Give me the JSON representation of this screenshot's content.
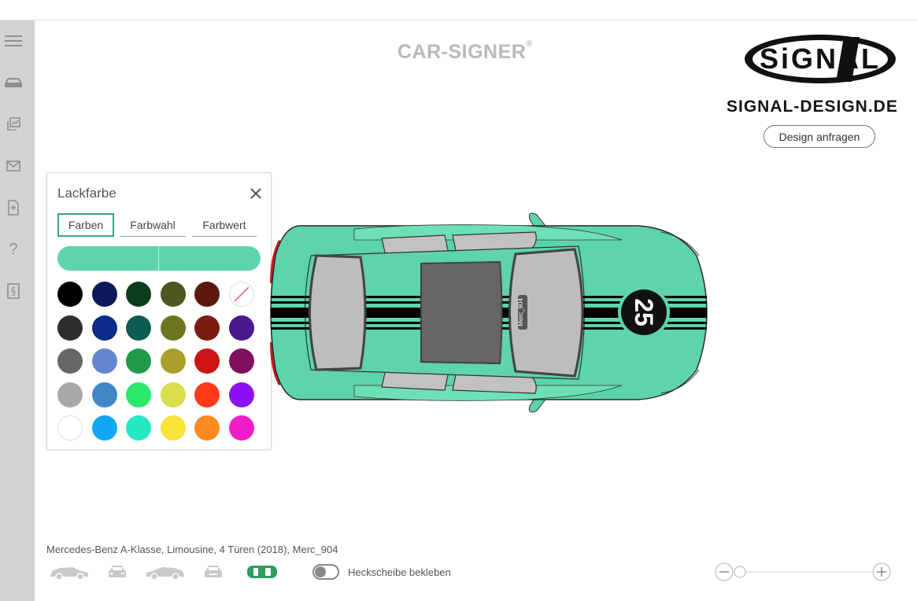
{
  "brand": {
    "name": "CAR-SIGNER",
    "registered": "®"
  },
  "logo": {
    "text": "SiGNAL"
  },
  "site": {
    "domain": "SIGNAL-DESIGN.DE"
  },
  "actions": {
    "request_design": "Design anfragen"
  },
  "sidebar": {
    "items": [
      {
        "icon": "menu-icon"
      },
      {
        "icon": "car-icon"
      },
      {
        "icon": "gallery-icon"
      },
      {
        "icon": "mail-icon"
      },
      {
        "icon": "document-icon"
      },
      {
        "icon": "help-icon",
        "glyph": "?"
      },
      {
        "icon": "legal-icon",
        "glyph": "§"
      }
    ]
  },
  "paint_panel": {
    "title": "Lackfarbe",
    "tabs": [
      {
        "label": "Farben",
        "active": true
      },
      {
        "label": "Farbwahl",
        "active": false
      },
      {
        "label": "Farbwert",
        "active": false
      }
    ],
    "current_color": "#5dd4a9",
    "swatches": [
      [
        "#000000",
        "#0d1a5a",
        "#0b3d1d",
        "#4f5520",
        "#5b180d",
        "none"
      ],
      [
        "#2e2e2e",
        "#0c2b8a",
        "#0d5c50",
        "#6b7520",
        "#7a1c10",
        "#4a1a8c"
      ],
      [
        "#666666",
        "#6485cf",
        "#1e9b4a",
        "#a8a02a",
        "#cc1414",
        "#7e0f5e"
      ],
      [
        "#a8a8a8",
        "#3f88c5",
        "#29e86a",
        "#d9df4c",
        "#ff3a1a",
        "#8a12f2"
      ],
      [
        "#ffffff",
        "#12a7f3",
        "#24e8c4",
        "#fbe33a",
        "#ff8a22",
        "#f01ec8"
      ]
    ]
  },
  "car": {
    "paint_color": "#5dd4a9",
    "start_number": "25",
    "plate_text": "Merc_904"
  },
  "model": {
    "description": "Mercedes-Benz A-Klasse, Limousine, 4 Türen (2018), Merc_904"
  },
  "views": {
    "icons": [
      "side-view-left-icon",
      "front-view-icon",
      "side-view-right-icon",
      "rear-view-icon",
      "top-view-icon"
    ],
    "active_index": 4,
    "active_color": "#2e9e5f"
  },
  "rear_window": {
    "label": "Heckscheibe bekleben",
    "enabled": false
  },
  "zoom": {
    "level": 0.05
  }
}
